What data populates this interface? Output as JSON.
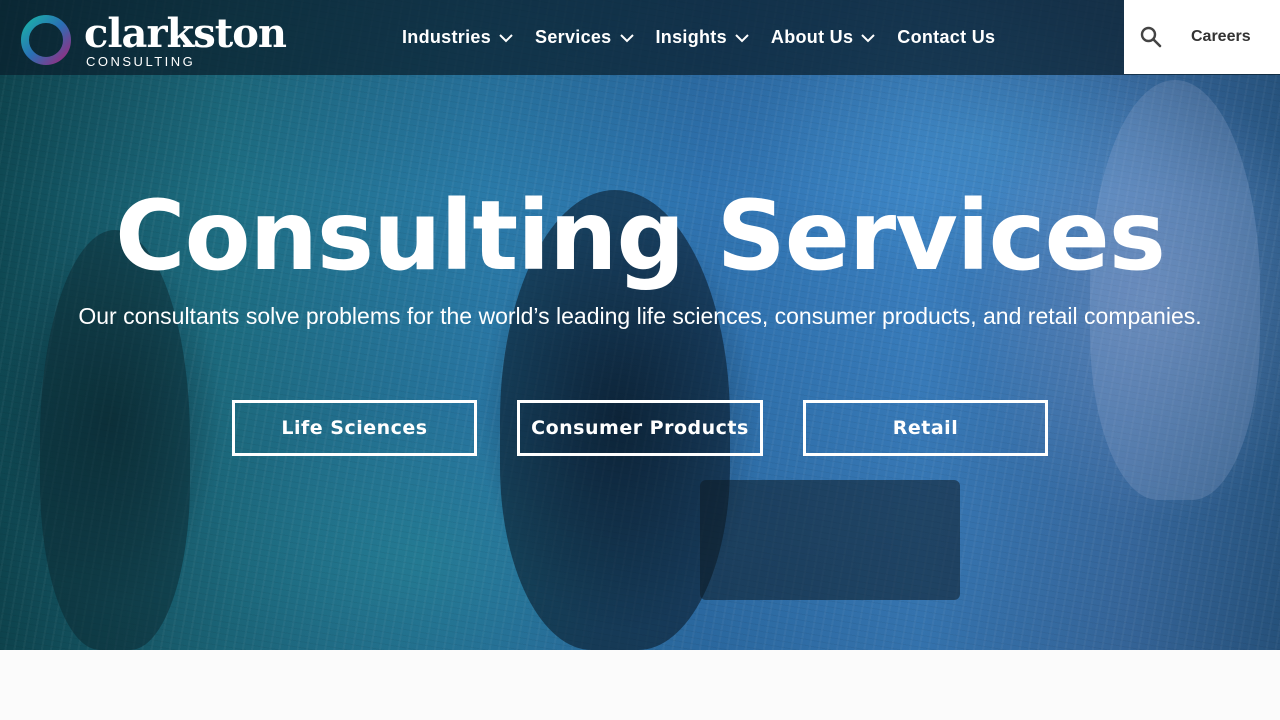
{
  "brand": {
    "name": "clarkston",
    "tagline": "CONSULTING",
    "colors": {
      "teal": "#1ab0a8",
      "magenta": "#9b2a7e",
      "blue": "#2f6fb3"
    }
  },
  "nav": {
    "items": [
      {
        "label": "Industries",
        "has_dropdown": true
      },
      {
        "label": "Services",
        "has_dropdown": true
      },
      {
        "label": "Insights",
        "has_dropdown": true
      },
      {
        "label": "About Us",
        "has_dropdown": true
      },
      {
        "label": "Contact Us",
        "has_dropdown": false
      }
    ],
    "search_icon": "search-icon",
    "careers_label": "Careers"
  },
  "hero": {
    "title": "Consulting Services",
    "subtitle": "Our consultants solve problems for the world’s leading life sciences, consumer products, and retail companies.",
    "buttons": [
      {
        "label": "Life Sciences"
      },
      {
        "label": "Consumer Products"
      },
      {
        "label": "Retail"
      }
    ]
  }
}
